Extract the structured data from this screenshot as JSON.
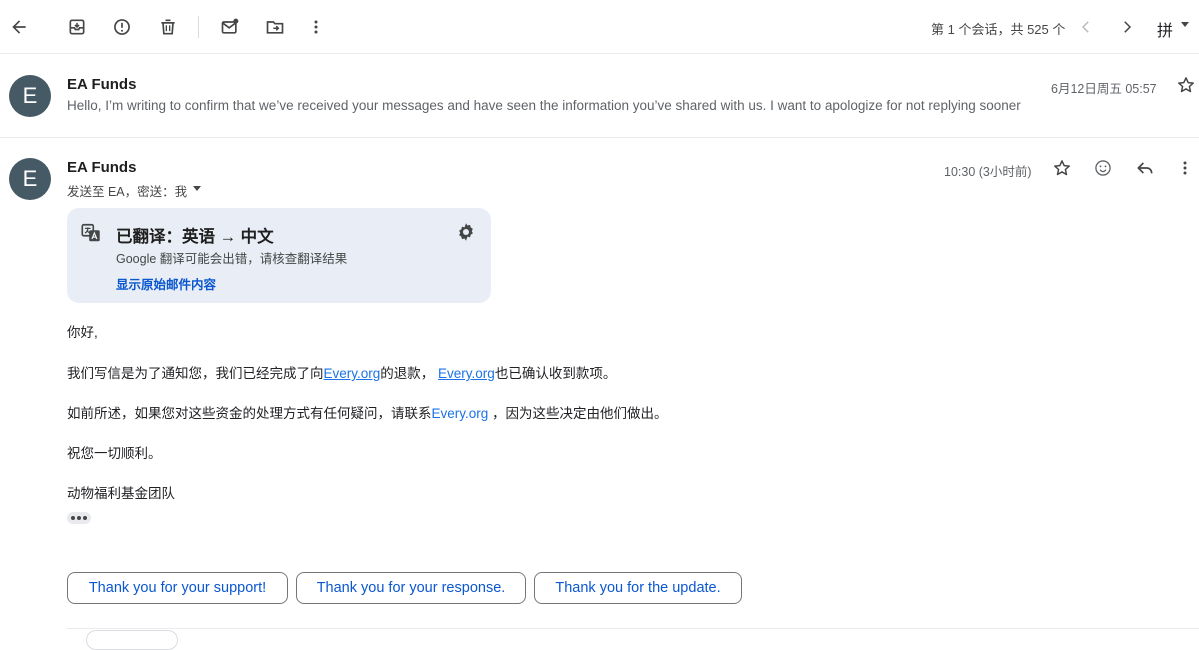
{
  "toolbar": {
    "icons": [
      "back-arrow-icon",
      "archive-icon",
      "report-spam-icon",
      "delete-icon",
      "mark-unread-icon",
      "move-to-icon",
      "more-vert-icon"
    ],
    "pager_text": "第 1 个会话，共 525 个",
    "ime_label": "拼"
  },
  "collapsed_message": {
    "avatar_letter": "E",
    "sender": "EA Funds",
    "snippet": "Hello, I’m writing to confirm that we’ve received your messages and have seen the information you’ve shared with us. I want to apologize for not replying sooner",
    "date": "6月12日周五 05:57"
  },
  "open_message": {
    "avatar_letter": "E",
    "sender": "EA Funds",
    "recipients": "发送至 EA，密送：我",
    "time": "10:30 (3小时前)"
  },
  "translation": {
    "title": "已翻译：英语 → 中文",
    "note": "Google 翻译可能会出错，请核查翻译结果",
    "show_original": "显示原始邮件内容"
  },
  "body": {
    "greeting": "你好,",
    "line1_a": "我们写信是为了通知您，我们已经完成了向",
    "line1_link1": "Every.org",
    "line1_b": "的退款， ",
    "line1_link2": "Every.org",
    "line1_c": "也已确认收到款项。",
    "line2_a": "如前所述，如果您对这些资金的处理方式有任何疑问，请联系",
    "line2_link": "Every.org",
    "line2_b": " ，因为这些决定由他们做出。",
    "closing": "祝您一切顺利。",
    "signature": "动物福利基金团队"
  },
  "smart_replies": [
    "Thank you for your support!",
    "Thank you for your response.",
    "Thank you for the update."
  ],
  "colors": {
    "avatar": "#455a64",
    "card_bg": "#e9eef6",
    "link": "#1a73e8",
    "chip_text": "#0b57d0"
  }
}
